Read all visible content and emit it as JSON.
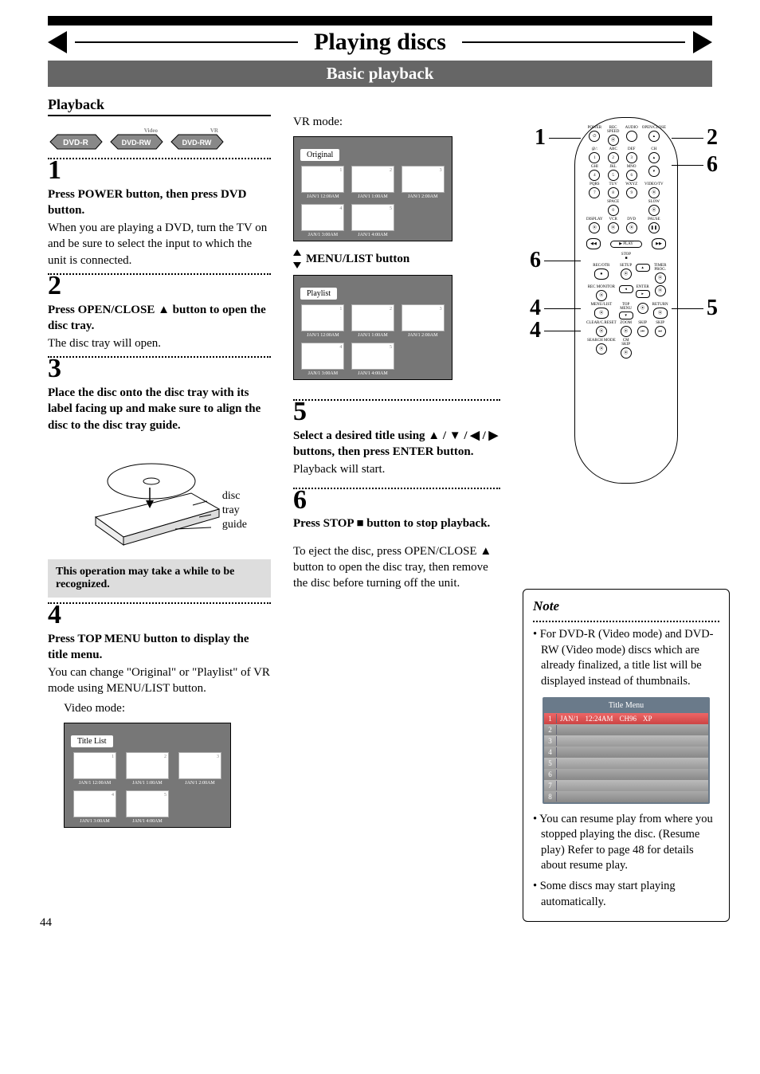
{
  "page": {
    "number": "44",
    "title": "Playing discs",
    "subtitle": "Basic playback"
  },
  "section": {
    "playback": "Playback"
  },
  "badges": {
    "a": "DVD-R",
    "b": "DVD-RW",
    "b_sup": "Video",
    "c": "DVD-RW",
    "c_sup": "VR"
  },
  "step1": {
    "num": "1",
    "bold": "Press POWER button, then press DVD button.",
    "body": "When you are playing a DVD, turn the TV on and be sure to select the input to which the unit is connected."
  },
  "step2": {
    "num": "2",
    "bold": "Press OPEN/CLOSE ▲ button to open the disc tray.",
    "body": "The disc tray will open."
  },
  "step3": {
    "num": "3",
    "bold": "Place the disc onto the disc tray with its label facing up and make sure to align the disc to the disc tray guide.",
    "labels": {
      "a": "disc",
      "b": "tray",
      "c": "guide"
    },
    "gray": "This operation may take a while to be recognized."
  },
  "step4": {
    "num": "4",
    "bold": "Press TOP MENU button to display the title menu.",
    "body": "You can change \"Original\" or \"Playlist\" of VR mode using MENU/LIST button.",
    "videomode": "Video mode:"
  },
  "vr": {
    "label": "VR mode:",
    "menulist": "MENU/LIST button"
  },
  "titlelist": {
    "hdr": "Title List",
    "t": [
      "JAN/1   12:00AM",
      "JAN/1    1:00AM",
      "JAN/1    2:00AM",
      "JAN/1    3:00AM",
      "JAN/1    4:00AM"
    ],
    "n": [
      "1",
      "2",
      "3",
      "4",
      "5"
    ]
  },
  "orig": {
    "hdr": "Original",
    "t": [
      "JAN/1   12:00AM",
      "JAN/1    1:00AM",
      "JAN/1    2:00AM",
      "JAN/1    3:00AM",
      "JAN/1    4:00AM"
    ],
    "n": [
      "1",
      "2",
      "3",
      "4",
      "5"
    ]
  },
  "play": {
    "hdr": "Playlist",
    "t": [
      "JAN/1   12:00AM",
      "JAN/1    1:00AM",
      "JAN/1    2:00AM",
      "JAN/1    3:00AM",
      "JAN/1    4:00AM"
    ],
    "n": [
      "1",
      "2",
      "3",
      "4",
      "5"
    ]
  },
  "step5": {
    "num": "5",
    "bold": "Select a desired title using ▲ / ▼ / ◀ / ▶ buttons, then press ENTER button.",
    "body": "Playback will start."
  },
  "step6": {
    "num": "6",
    "bold": "Press STOP ■ button to stop playback.",
    "body": "To eject the disc, press OPEN/CLOSE ▲ button to open the disc tray, then remove the disc before turning off the unit."
  },
  "remote": {
    "labels": [
      "POWER",
      "REC SPEED",
      "AUDIO",
      "OPEN/CLOSE",
      "@/:",
      "ABC",
      "DEF",
      "GHI",
      "JKL",
      "MNO",
      "CH",
      "PQRS",
      "TUV",
      "WXYZ",
      "VIDEO/TV",
      "SPACE",
      "SLOW",
      "DISPLAY",
      "VCR",
      "DVD",
      "PAUSE",
      "PLAY",
      "STOP",
      "REC/OTR",
      "SETUP",
      "TIMER PROG.",
      "ENTER",
      "REC MONITOR",
      "MENU/LIST",
      "TOP MENU",
      "RETURN",
      "CLEAR/C.RESET",
      "ZOOM",
      "SKIP",
      "SKIP",
      "SEARCH MODE",
      "CM SKIP"
    ],
    "nums": [
      "1",
      "2",
      "3",
      "4",
      "5",
      "6",
      "7",
      "8",
      "9",
      "0"
    ]
  },
  "callouts": {
    "c1": "1",
    "c2": "2",
    "c6a": "6",
    "c6b": "6",
    "c4a": "4",
    "c4b": "4",
    "c5": "5"
  },
  "note": {
    "title": "Note",
    "a": "For DVD-R (Video mode) and DVD-RW (Video mode) discs which are already finalized, a title list will be displayed instead of thumbnails.",
    "b": "You can resume play from where you stopped playing the disc. (Resume play) Refer to page 48 for details about resume play.",
    "c": "Some discs may start playing automatically."
  },
  "titlemenu": {
    "hdr": "Title Menu",
    "row": {
      "n": "1",
      "d": "JAN/1",
      "t": "12:24AM",
      "ch": "CH96",
      "m": "XP"
    }
  }
}
